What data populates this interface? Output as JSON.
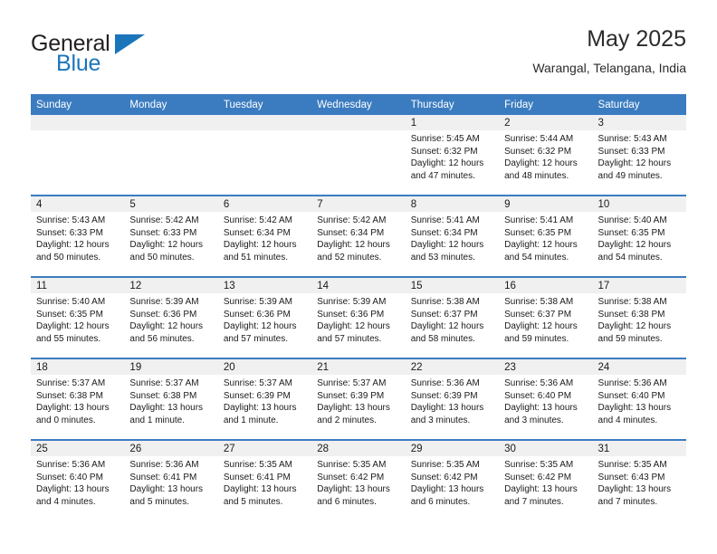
{
  "brand": {
    "name_top": "General",
    "name_bottom": "Blue",
    "color_primary": "#1b75bb",
    "triangle_icon": "triangle-icon"
  },
  "header": {
    "title": "May 2025",
    "subtitle": "Warangal, Telangana, India"
  },
  "colors": {
    "header_row": "#3b7cc0",
    "date_band": "#f0f0f0",
    "row_divider": "#3b7cc0"
  },
  "weekday_headers": [
    "Sunday",
    "Monday",
    "Tuesday",
    "Wednesday",
    "Thursday",
    "Friday",
    "Saturday"
  ],
  "weeks": [
    [
      {
        "day": "",
        "sunrise": "",
        "sunset": "",
        "daylight_1": "",
        "daylight_2": "",
        "empty": true
      },
      {
        "day": "",
        "sunrise": "",
        "sunset": "",
        "daylight_1": "",
        "daylight_2": "",
        "empty": true
      },
      {
        "day": "",
        "sunrise": "",
        "sunset": "",
        "daylight_1": "",
        "daylight_2": "",
        "empty": true
      },
      {
        "day": "",
        "sunrise": "",
        "sunset": "",
        "daylight_1": "",
        "daylight_2": "",
        "empty": true
      },
      {
        "day": "1",
        "sunrise": "Sunrise: 5:45 AM",
        "sunset": "Sunset: 6:32 PM",
        "daylight_1": "Daylight: 12 hours",
        "daylight_2": "and 47 minutes.",
        "empty": false
      },
      {
        "day": "2",
        "sunrise": "Sunrise: 5:44 AM",
        "sunset": "Sunset: 6:32 PM",
        "daylight_1": "Daylight: 12 hours",
        "daylight_2": "and 48 minutes.",
        "empty": false
      },
      {
        "day": "3",
        "sunrise": "Sunrise: 5:43 AM",
        "sunset": "Sunset: 6:33 PM",
        "daylight_1": "Daylight: 12 hours",
        "daylight_2": "and 49 minutes.",
        "empty": false
      }
    ],
    [
      {
        "day": "4",
        "sunrise": "Sunrise: 5:43 AM",
        "sunset": "Sunset: 6:33 PM",
        "daylight_1": "Daylight: 12 hours",
        "daylight_2": "and 50 minutes.",
        "empty": false
      },
      {
        "day": "5",
        "sunrise": "Sunrise: 5:42 AM",
        "sunset": "Sunset: 6:33 PM",
        "daylight_1": "Daylight: 12 hours",
        "daylight_2": "and 50 minutes.",
        "empty": false
      },
      {
        "day": "6",
        "sunrise": "Sunrise: 5:42 AM",
        "sunset": "Sunset: 6:34 PM",
        "daylight_1": "Daylight: 12 hours",
        "daylight_2": "and 51 minutes.",
        "empty": false
      },
      {
        "day": "7",
        "sunrise": "Sunrise: 5:42 AM",
        "sunset": "Sunset: 6:34 PM",
        "daylight_1": "Daylight: 12 hours",
        "daylight_2": "and 52 minutes.",
        "empty": false
      },
      {
        "day": "8",
        "sunrise": "Sunrise: 5:41 AM",
        "sunset": "Sunset: 6:34 PM",
        "daylight_1": "Daylight: 12 hours",
        "daylight_2": "and 53 minutes.",
        "empty": false
      },
      {
        "day": "9",
        "sunrise": "Sunrise: 5:41 AM",
        "sunset": "Sunset: 6:35 PM",
        "daylight_1": "Daylight: 12 hours",
        "daylight_2": "and 54 minutes.",
        "empty": false
      },
      {
        "day": "10",
        "sunrise": "Sunrise: 5:40 AM",
        "sunset": "Sunset: 6:35 PM",
        "daylight_1": "Daylight: 12 hours",
        "daylight_2": "and 54 minutes.",
        "empty": false
      }
    ],
    [
      {
        "day": "11",
        "sunrise": "Sunrise: 5:40 AM",
        "sunset": "Sunset: 6:35 PM",
        "daylight_1": "Daylight: 12 hours",
        "daylight_2": "and 55 minutes.",
        "empty": false
      },
      {
        "day": "12",
        "sunrise": "Sunrise: 5:39 AM",
        "sunset": "Sunset: 6:36 PM",
        "daylight_1": "Daylight: 12 hours",
        "daylight_2": "and 56 minutes.",
        "empty": false
      },
      {
        "day": "13",
        "sunrise": "Sunrise: 5:39 AM",
        "sunset": "Sunset: 6:36 PM",
        "daylight_1": "Daylight: 12 hours",
        "daylight_2": "and 57 minutes.",
        "empty": false
      },
      {
        "day": "14",
        "sunrise": "Sunrise: 5:39 AM",
        "sunset": "Sunset: 6:36 PM",
        "daylight_1": "Daylight: 12 hours",
        "daylight_2": "and 57 minutes.",
        "empty": false
      },
      {
        "day": "15",
        "sunrise": "Sunrise: 5:38 AM",
        "sunset": "Sunset: 6:37 PM",
        "daylight_1": "Daylight: 12 hours",
        "daylight_2": "and 58 minutes.",
        "empty": false
      },
      {
        "day": "16",
        "sunrise": "Sunrise: 5:38 AM",
        "sunset": "Sunset: 6:37 PM",
        "daylight_1": "Daylight: 12 hours",
        "daylight_2": "and 59 minutes.",
        "empty": false
      },
      {
        "day": "17",
        "sunrise": "Sunrise: 5:38 AM",
        "sunset": "Sunset: 6:38 PM",
        "daylight_1": "Daylight: 12 hours",
        "daylight_2": "and 59 minutes.",
        "empty": false
      }
    ],
    [
      {
        "day": "18",
        "sunrise": "Sunrise: 5:37 AM",
        "sunset": "Sunset: 6:38 PM",
        "daylight_1": "Daylight: 13 hours",
        "daylight_2": "and 0 minutes.",
        "empty": false
      },
      {
        "day": "19",
        "sunrise": "Sunrise: 5:37 AM",
        "sunset": "Sunset: 6:38 PM",
        "daylight_1": "Daylight: 13 hours",
        "daylight_2": "and 1 minute.",
        "empty": false
      },
      {
        "day": "20",
        "sunrise": "Sunrise: 5:37 AM",
        "sunset": "Sunset: 6:39 PM",
        "daylight_1": "Daylight: 13 hours",
        "daylight_2": "and 1 minute.",
        "empty": false
      },
      {
        "day": "21",
        "sunrise": "Sunrise: 5:37 AM",
        "sunset": "Sunset: 6:39 PM",
        "daylight_1": "Daylight: 13 hours",
        "daylight_2": "and 2 minutes.",
        "empty": false
      },
      {
        "day": "22",
        "sunrise": "Sunrise: 5:36 AM",
        "sunset": "Sunset: 6:39 PM",
        "daylight_1": "Daylight: 13 hours",
        "daylight_2": "and 3 minutes.",
        "empty": false
      },
      {
        "day": "23",
        "sunrise": "Sunrise: 5:36 AM",
        "sunset": "Sunset: 6:40 PM",
        "daylight_1": "Daylight: 13 hours",
        "daylight_2": "and 3 minutes.",
        "empty": false
      },
      {
        "day": "24",
        "sunrise": "Sunrise: 5:36 AM",
        "sunset": "Sunset: 6:40 PM",
        "daylight_1": "Daylight: 13 hours",
        "daylight_2": "and 4 minutes.",
        "empty": false
      }
    ],
    [
      {
        "day": "25",
        "sunrise": "Sunrise: 5:36 AM",
        "sunset": "Sunset: 6:40 PM",
        "daylight_1": "Daylight: 13 hours",
        "daylight_2": "and 4 minutes.",
        "empty": false
      },
      {
        "day": "26",
        "sunrise": "Sunrise: 5:36 AM",
        "sunset": "Sunset: 6:41 PM",
        "daylight_1": "Daylight: 13 hours",
        "daylight_2": "and 5 minutes.",
        "empty": false
      },
      {
        "day": "27",
        "sunrise": "Sunrise: 5:35 AM",
        "sunset": "Sunset: 6:41 PM",
        "daylight_1": "Daylight: 13 hours",
        "daylight_2": "and 5 minutes.",
        "empty": false
      },
      {
        "day": "28",
        "sunrise": "Sunrise: 5:35 AM",
        "sunset": "Sunset: 6:42 PM",
        "daylight_1": "Daylight: 13 hours",
        "daylight_2": "and 6 minutes.",
        "empty": false
      },
      {
        "day": "29",
        "sunrise": "Sunrise: 5:35 AM",
        "sunset": "Sunset: 6:42 PM",
        "daylight_1": "Daylight: 13 hours",
        "daylight_2": "and 6 minutes.",
        "empty": false
      },
      {
        "day": "30",
        "sunrise": "Sunrise: 5:35 AM",
        "sunset": "Sunset: 6:42 PM",
        "daylight_1": "Daylight: 13 hours",
        "daylight_2": "and 7 minutes.",
        "empty": false
      },
      {
        "day": "31",
        "sunrise": "Sunrise: 5:35 AM",
        "sunset": "Sunset: 6:43 PM",
        "daylight_1": "Daylight: 13 hours",
        "daylight_2": "and 7 minutes.",
        "empty": false
      }
    ]
  ]
}
